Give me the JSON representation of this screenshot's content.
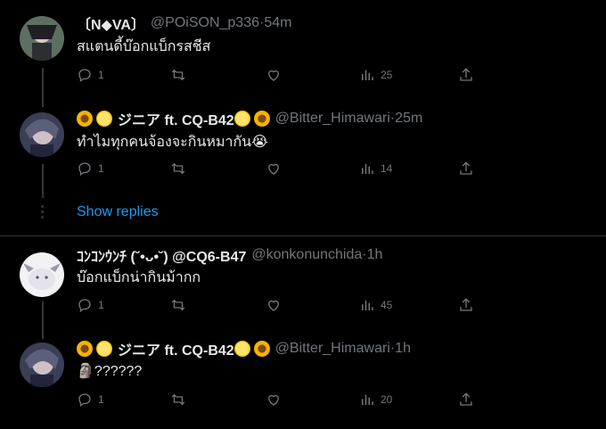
{
  "tweets": [
    {
      "display_name": "〔N◆VA〕",
      "handle": "@POiSON_p336",
      "sep": "·",
      "time": "54m",
      "text": "สแตนดี้บ๊อกแบ็กรสชีส",
      "replies": "1",
      "retweets": "",
      "likes": "",
      "views": "25"
    },
    {
      "display_name": "ジニア ft. CQ-B42",
      "handle": "@Bitter_Himawari",
      "sep": "·",
      "time": "25m",
      "text": "ทำไมทุกคนจ้องจะกินหมากัน😭",
      "replies": "1",
      "retweets": "",
      "likes": "",
      "views": "14"
    },
    {
      "display_name": "ｺﾝｺﾝｳﾝﾁ (˘•ᴗ•˘) @CQ6-B47",
      "handle": "@konkonunchida",
      "sep": "·",
      "time": "1h",
      "text": "บ๊อกแบ็กน่ากินม้ากก",
      "replies": "1",
      "retweets": "",
      "likes": "",
      "views": "45"
    },
    {
      "display_name": "ジニア ft. CQ-B42",
      "handle": "@Bitter_Himawari",
      "sep": "·",
      "time": "1h",
      "text": "🗿??????",
      "replies": "1",
      "retweets": "",
      "likes": "",
      "views": "20"
    }
  ],
  "show_replies_label": "Show replies",
  "colors": {
    "background": "#000000",
    "accent": "#1d9bf0",
    "muted": "#71767b",
    "text": "#e7e9ea"
  },
  "icons": {
    "reply": "reply-icon",
    "retweet": "retweet-icon",
    "like": "heart-icon",
    "views": "views-icon",
    "share": "share-icon"
  }
}
